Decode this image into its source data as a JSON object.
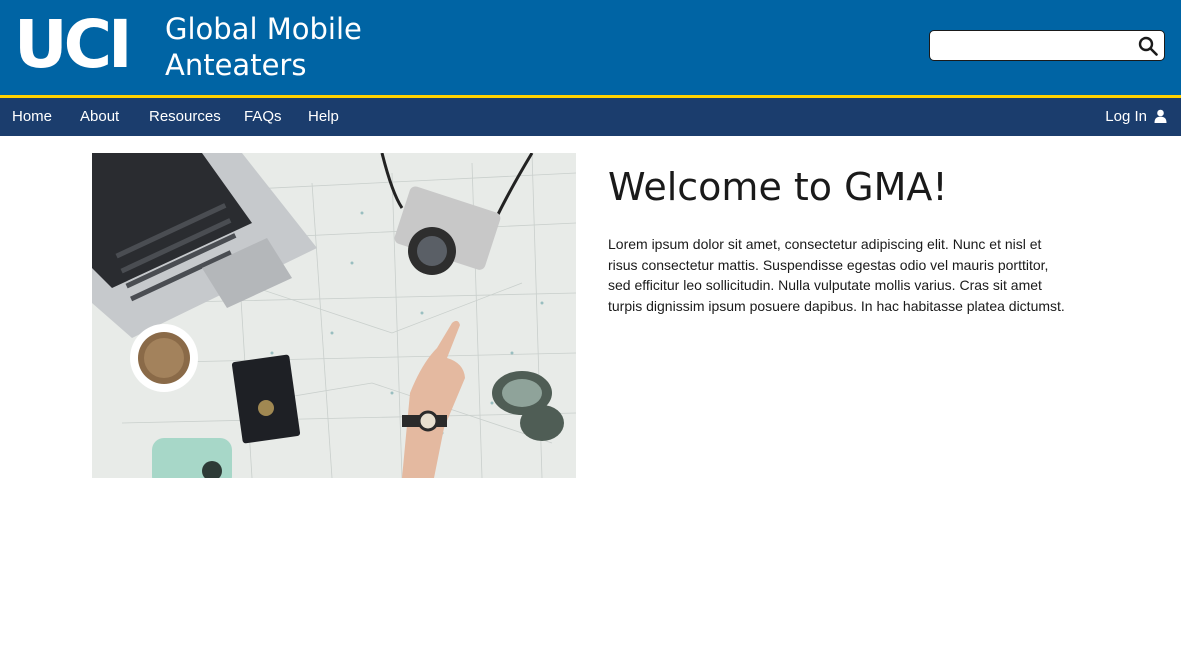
{
  "header": {
    "logo_text": "UCI",
    "title_line1": "Global Mobile",
    "title_line2": "Anteaters",
    "search": {
      "value": "",
      "placeholder": "",
      "icon": "search-icon"
    },
    "colors": {
      "header_bg": "#0064a4",
      "accent_border": "#ffd200",
      "nav_bg": "#1b3d6d"
    }
  },
  "nav": {
    "items": [
      {
        "label": "Home"
      },
      {
        "label": "About"
      },
      {
        "label": "Resources"
      },
      {
        "label": "FAQs"
      },
      {
        "label": "Help"
      }
    ],
    "login": {
      "label": "Log In",
      "icon": "user-icon"
    }
  },
  "main": {
    "hero_image": "travel-map-photo",
    "heading": "Welcome to GMA!",
    "body": "Lorem ipsum dolor sit amet, consectetur adipiscing elit. Nunc et nisl et risus consectetur mattis. Suspendisse egestas odio vel mauris porttitor, sed efficitur leo sollicitudin. Nulla vulputate mollis varius. Cras sit amet turpis dignissim ipsum posuere dapibus. In hac habitasse platea dictumst."
  }
}
